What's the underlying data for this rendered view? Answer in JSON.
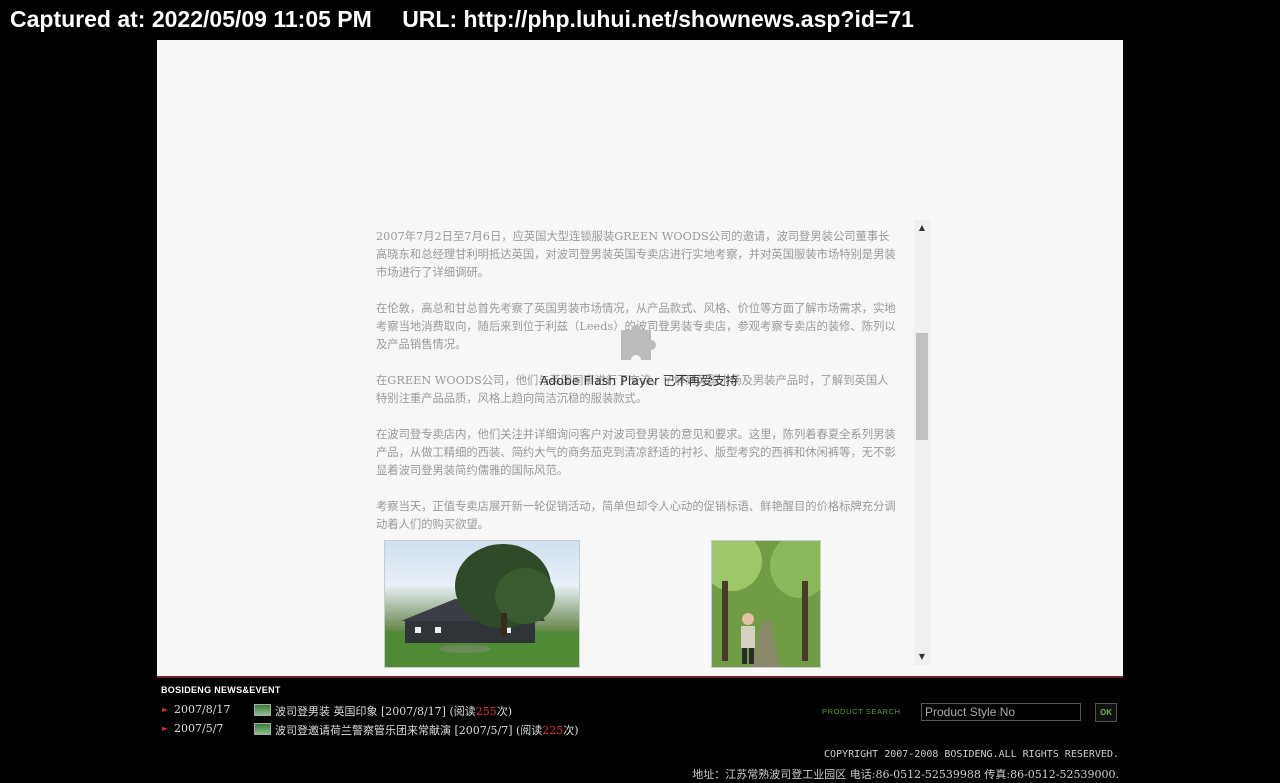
{
  "capture": {
    "captured_at": "Captured at: 2022/05/09 11:05 PM",
    "url": "URL: http://php.luhui.net/shownews.asp?id=71"
  },
  "article": {
    "paragraphs": [
      "2007年7月2日至7月6日，应英国大型连锁服装GREEN WOODS公司的邀请，波司登男装公司董事长高晓东和总经理甘利明抵达英国，对波司登男装英国专卖店进行实地考察，并对英国服装市场特别是男装市场进行了详细调研。",
      "在伦敦，高总和甘总首先考察了英国男装市场情况，从产品款式、风格、价位等方面了解市场需求，实地考察当地消费取向，随后来到位于利兹（Leeds）的波司登男装专卖店，参观考察专卖店的装修、陈列以及产品销售情况。",
      "在GREEN WOODS公司，他们与英国同事进行了交流，了解到英国市场及男装产品时，了解到英国人特别注重产品品质，风格上趋向简洁沉稳的服装款式。",
      "在波司登专卖店内，他们关注并详细询问客户对波司登男装的意见和要求。这里，陈列着春夏全系列男装产品，从做工精细的西装、简约大气的商务茄克到清凉舒适的衬衫、版型考究的西裤和休闲裤等，无不彰显着波司登男装简约儒雅的国际风范。",
      "考察当天，正值专卖店展开新一轮促销活动，简单但却令人心动的促销标语、鲜艳醒目的价格标牌充分调动着人们的购买欲望。"
    ]
  },
  "plugin": {
    "message": "Adobe Flash Player 已不再受支持",
    "icon": "puzzle-piece-icon"
  },
  "scrollbar": {
    "up": "▲",
    "down": "▼"
  },
  "news": {
    "title": "BOSIDENG NEWS&EVENT",
    "items": [
      {
        "date": "2007/8/17",
        "text": "波司登男装 英国印象 [2007/8/17] (阅读",
        "count": "255",
        "suffix": "次)"
      },
      {
        "date": "2007/5/7",
        "text": "波司登邀请荷兰警察管乐团来常献演 [2007/5/7] (阅读",
        "count": "225",
        "suffix": "次)"
      }
    ]
  },
  "product_search": {
    "label": "PRODUCT SEARCH",
    "placeholder": "Product Style No",
    "ok_label": "OK"
  },
  "footer": {
    "copyright": "COPYRIGHT 2007-2008 BOSIDENG.ALL RIGHTS RESERVED.",
    "address": "地址：江苏常熟波司登工业园区 电话:86-0512-52539988 传真:86-0512-52539000."
  },
  "colors": {
    "accent_red": "#e03030",
    "search_green": "#5a9a3a",
    "rule": "#7a1a2a"
  }
}
